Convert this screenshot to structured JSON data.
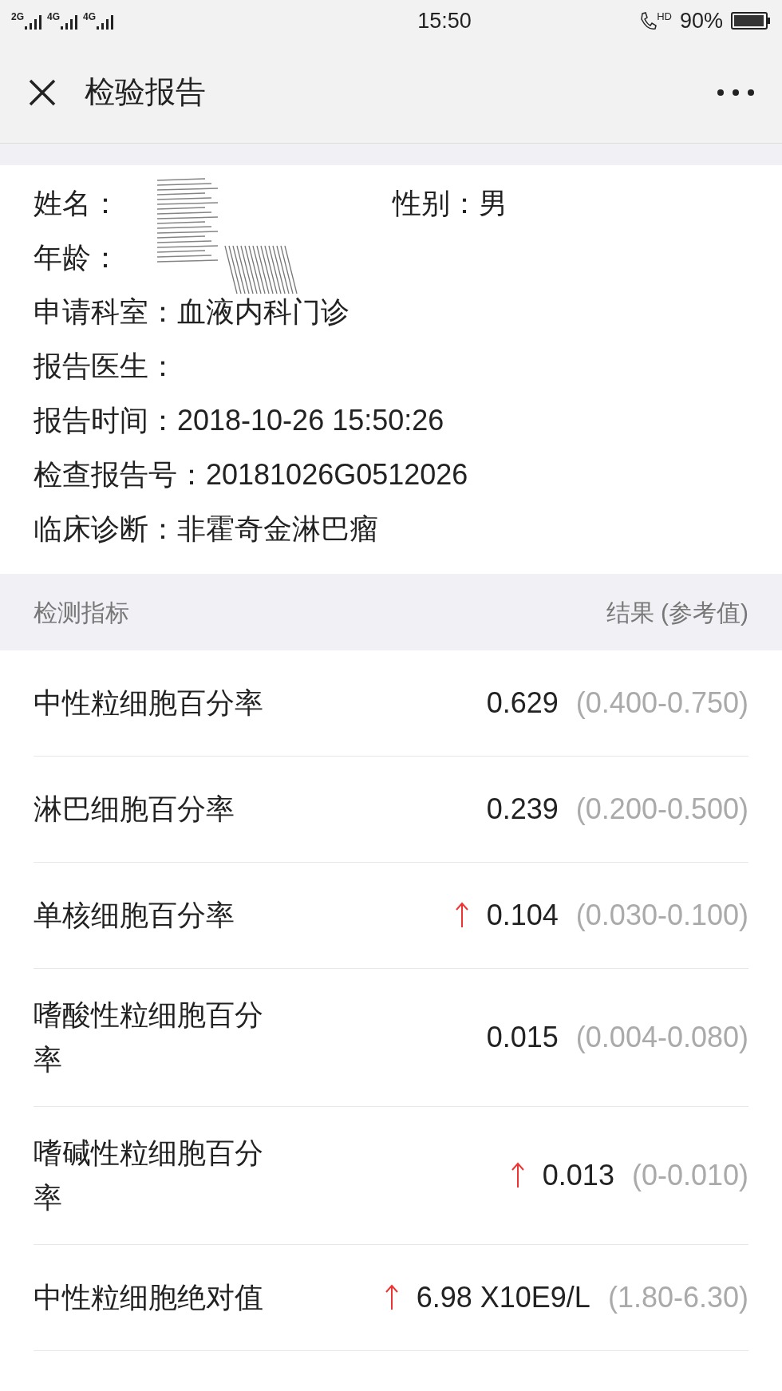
{
  "status_bar": {
    "networks": [
      "2G",
      "4G",
      "4G"
    ],
    "time": "15:50",
    "call_label": "HD",
    "battery": "90%"
  },
  "header": {
    "title": "检验报告"
  },
  "patient": {
    "name_label": "姓名：",
    "gender_label": "性别：",
    "gender": "男",
    "age_label": "年龄：",
    "fields": [
      {
        "label": "申请科室：",
        "value": "血液内科门诊"
      },
      {
        "label": "报告医生："
      },
      {
        "label": "报告时间：",
        "value": "2018-10-26 15:50:26"
      },
      {
        "label": "检查报告号：",
        "value": "20181026G0512026"
      },
      {
        "label": "临床诊断：",
        "value": "非霍奇金淋巴瘤"
      }
    ]
  },
  "table": {
    "columns": [
      "检测指标",
      "结果 (参考值)"
    ],
    "rows": [
      {
        "name": "中性粒细胞百分率",
        "high": false,
        "value": "0.629",
        "reference": "(0.400-0.750)"
      },
      {
        "name": "淋巴细胞百分率",
        "high": false,
        "value": "0.239",
        "reference": "(0.200-0.500)"
      },
      {
        "name": "单核细胞百分率",
        "high": true,
        "value": "0.104",
        "reference": "(0.030-0.100)"
      },
      {
        "name": "嗜酸性粒细胞百分率",
        "high": false,
        "value": "0.015",
        "reference": "(0.004-0.080)"
      },
      {
        "name": "嗜碱性粒细胞百分率",
        "high": true,
        "value": "0.013",
        "reference": "(0-0.010)"
      },
      {
        "name": "中性粒细胞绝对值",
        "high": true,
        "value": "6.98 X10E9/L",
        "reference": "(1.80-6.30)"
      }
    ]
  }
}
